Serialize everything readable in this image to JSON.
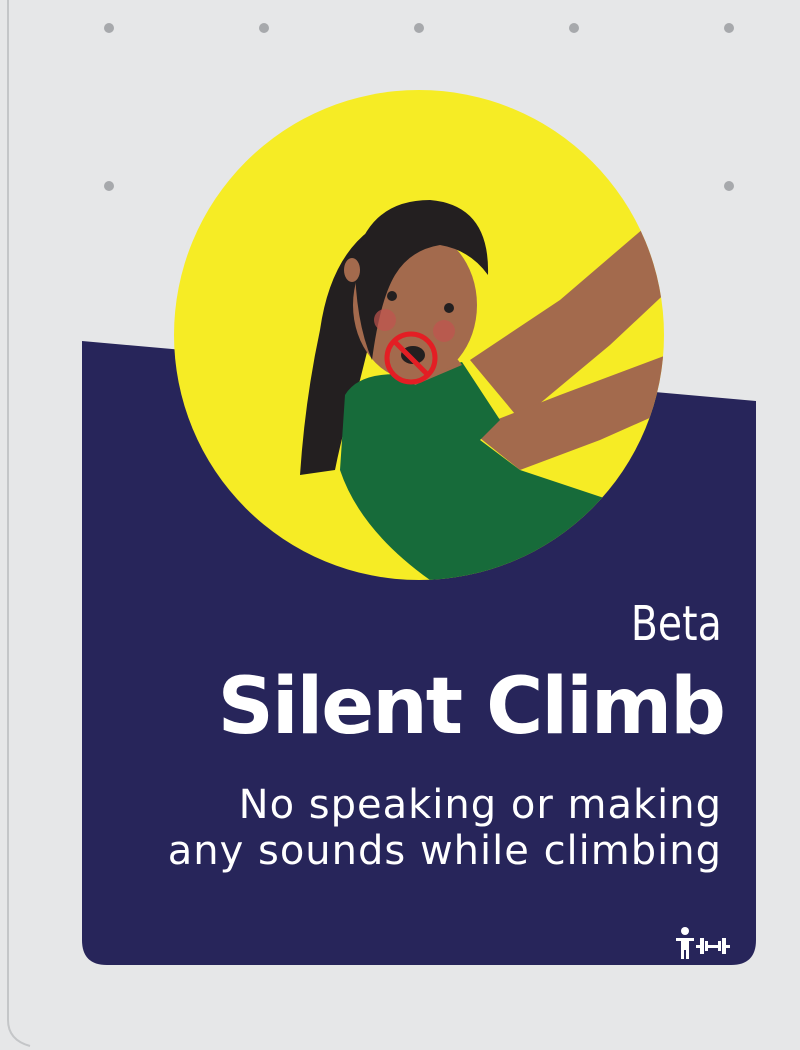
{
  "card": {
    "level": "Beta",
    "title": "Silent Climb",
    "description_lines": [
      "No speaking or making ",
      "any sounds while climbing"
    ],
    "icons": {
      "illustration": "climber-no-talking-illustration",
      "badge": "no-speaking-icon",
      "footer": "child-and-weight-icon"
    }
  },
  "colors": {
    "background": "#e6e7e8",
    "panel": "#27255a",
    "circle": "#f6ec25",
    "shirt": "#176b3a",
    "skin": "#a36a4d",
    "hair": "#231f20",
    "prohibit": "#e31e24",
    "dots": "#a7a9ac",
    "text": "#ffffff"
  }
}
